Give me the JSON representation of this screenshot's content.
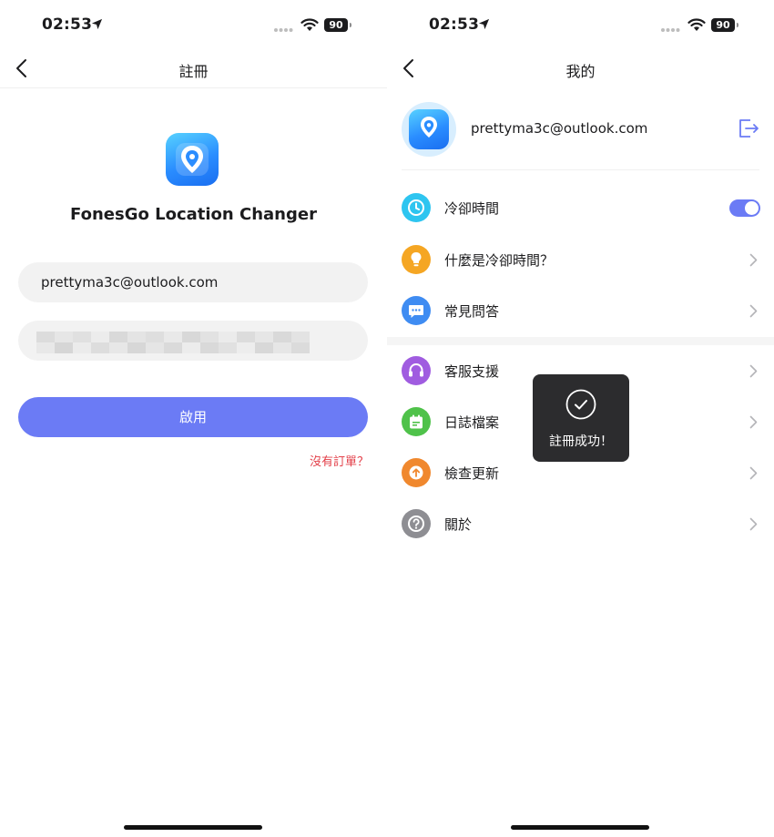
{
  "status_bar": {
    "time": "02:53",
    "battery": "90"
  },
  "register_screen": {
    "title": "註冊",
    "app_name": "FonesGo Location Changer",
    "email_value": "prettyma3c@outlook.com",
    "activate_label": "啟用",
    "no_order_label": "沒有訂單？"
  },
  "profile_screen": {
    "title": "我的",
    "user_email": "prettyma3c@outlook.com",
    "cooldown": {
      "label": "冷卻時間",
      "enabled": true
    },
    "menu_group1": [
      {
        "label": "什麼是冷卻時間？",
        "icon": "lightbulb-icon",
        "color": "#f5a623"
      },
      {
        "label": "常見問答",
        "icon": "chat-bubble-icon",
        "color": "#3f8cf2"
      }
    ],
    "menu_group2": [
      {
        "label": "客服支援",
        "icon": "headset-icon",
        "color": "#a05ce0"
      },
      {
        "label": "日誌檔案",
        "icon": "calendar-icon",
        "color": "#4fc24a"
      },
      {
        "label": "檢查更新",
        "icon": "update-arrow-icon",
        "color": "#f0882e"
      },
      {
        "label": "關於",
        "icon": "question-icon",
        "color": "#8e8e93"
      }
    ],
    "toast": "註冊成功！"
  },
  "colors": {
    "accent": "#6b7bf5",
    "link_red": "#e3404a",
    "cooldown_icon": "#2ec5f0"
  }
}
